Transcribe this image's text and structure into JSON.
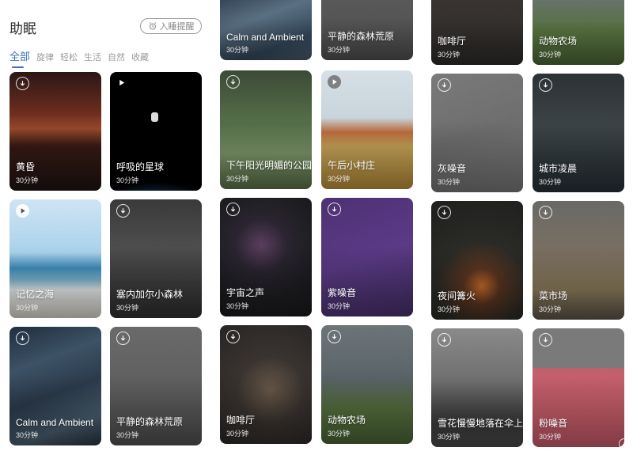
{
  "header": {
    "title": "助眠",
    "sleep_button": "入睡提醒"
  },
  "tabs": [
    "全部",
    "旋律",
    "轻松",
    "生活",
    "自然",
    "收藏"
  ],
  "cards": [
    {
      "title": "黄昏",
      "duration": "30分钟",
      "icon": "download-icon"
    },
    {
      "title": "呼吸的星球",
      "duration": "30分钟",
      "icon": "play-icon"
    },
    {
      "title": "记忆之海",
      "duration": "30分钟",
      "icon": "play-icon"
    },
    {
      "title": "塞内加尔小森林",
      "duration": "30分钟",
      "icon": "download-icon"
    },
    {
      "title": "Calm and Ambient",
      "duration": "30分钟",
      "icon": "download-icon"
    },
    {
      "title": "平静的森林荒原",
      "duration": "30分钟",
      "icon": "download-icon"
    },
    {
      "title": "Calm and Ambient",
      "duration": "30分钟"
    },
    {
      "title": "平静的森林荒原",
      "duration": "30分钟"
    },
    {
      "title": "下午阳光明媚的公园",
      "duration": "30分钟",
      "icon": "download-icon"
    },
    {
      "title": "午后小村庄",
      "duration": "30分钟",
      "icon": "play-icon"
    },
    {
      "title": "宇宙之声",
      "duration": "30分钟",
      "icon": "download-icon"
    },
    {
      "title": "紫噪音",
      "duration": "30分钟",
      "icon": "download-icon"
    },
    {
      "title": "咖啡厅",
      "duration": "30分钟",
      "icon": "download-icon"
    },
    {
      "title": "动物农场",
      "duration": "30分钟",
      "icon": "download-icon"
    },
    {
      "title": "咖啡厅",
      "duration": "30分钟"
    },
    {
      "title": "动物农场",
      "duration": "30分钟"
    },
    {
      "title": "灰噪音",
      "duration": "30分钟",
      "icon": "download-icon"
    },
    {
      "title": "城市凌晨",
      "duration": "30分钟",
      "icon": "download-icon"
    },
    {
      "title": "夜间篝火",
      "duration": "30分钟",
      "icon": "download-icon"
    },
    {
      "title": "菜市场",
      "duration": "30分钟",
      "icon": "download-icon"
    },
    {
      "title": "雪花慢慢地落在伞上",
      "duration": "30分钟",
      "icon": "download-icon"
    },
    {
      "title": "粉噪音",
      "duration": "30分钟",
      "icon": "download-icon"
    }
  ],
  "colors": {
    "accent": "#3f6fb7"
  }
}
